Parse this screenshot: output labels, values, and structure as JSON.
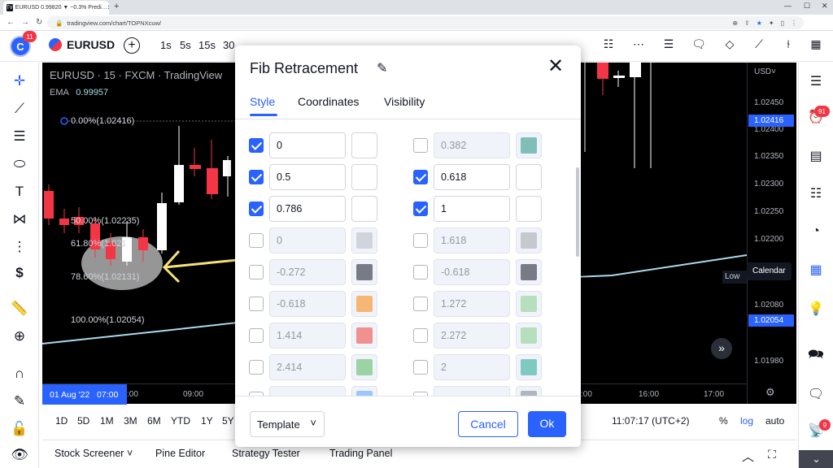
{
  "browser": {
    "tab_title": "EURUSD 0.99820 ▼ −0.3% Predi…",
    "favicon_text": "TV",
    "url": "tradingview.com/chart/TOPNXcuw/"
  },
  "toolbar": {
    "avatar_letter": "C",
    "avatar_badge": "11",
    "symbol": "EURUSD",
    "timeframes": [
      "1s",
      "5s",
      "15s",
      "30"
    ]
  },
  "chart": {
    "legend_title": "EURUSD · 15 · FXCM · TradingView",
    "ema_label": "EMA",
    "ema_value": "0.99957",
    "fib_labels": [
      "0.00%(1.02416)",
      "50.00%(1.02235)",
      "61.80%(1.021",
      "78.60%(1.02131)",
      "100.00%(1.02054)"
    ],
    "low_label": "Low",
    "calendar_tooltip": "Calendar",
    "price_axis": {
      "currency": "USD˅",
      "ticks": [
        "1.02450",
        "1.02400",
        "1.02350",
        "1.02300",
        "1.02250",
        "1.02200",
        "1.02080",
        "1.01980"
      ],
      "badge_top": "1.02416",
      "badge_bottom": "1.02054"
    },
    "time_axis": {
      "cursor": "01 Aug '22   07:00",
      "ticks": [
        ":00",
        "09:00",
        ":00",
        "16:00",
        "17:00"
      ]
    },
    "candle_colors": {
      "up": "#ffffff",
      "down": "#f23645"
    }
  },
  "bottom_bar": {
    "ranges": [
      "1D",
      "5D",
      "1M",
      "3M",
      "6M",
      "YTD",
      "1Y",
      "5Y"
    ],
    "clock": "11:07:17 (UTC+2)",
    "percent": "%",
    "log": "log",
    "auto": "auto"
  },
  "panels": [
    "Stock Screener",
    "Pine Editor",
    "Strategy Tester",
    "Trading Panel"
  ],
  "right_toolbar": {
    "alerts_badge": "91",
    "notif_badge": "9"
  },
  "dialog": {
    "title": "Fib Retracement",
    "tabs": [
      "Style",
      "Coordinates",
      "Visibility"
    ],
    "levels_left": [
      {
        "checked": true,
        "value": "0",
        "color": "#ffffff"
      },
      {
        "checked": true,
        "value": "0.5",
        "color": "#ffffff"
      },
      {
        "checked": true,
        "value": "0.786",
        "color": "#ffffff"
      },
      {
        "checked": false,
        "value": "0",
        "color": "#d1d4dc"
      },
      {
        "checked": false,
        "value": "-0.272",
        "color": "#787b86"
      },
      {
        "checked": false,
        "value": "-0.618",
        "color": "#f7b774"
      },
      {
        "checked": false,
        "value": "1.414",
        "color": "#f0908f"
      },
      {
        "checked": false,
        "value": "2.414",
        "color": "#9bd3a5"
      },
      {
        "checked": false,
        "value": "",
        "color": "#9fc5f8"
      }
    ],
    "levels_right": [
      {
        "checked": false,
        "value": "0.382",
        "color": "#7fbfb8"
      },
      {
        "checked": true,
        "value": "0.618",
        "color": "#ffffff"
      },
      {
        "checked": true,
        "value": "1",
        "color": "#ffffff"
      },
      {
        "checked": false,
        "value": "1.618",
        "color": "#c5c8ce"
      },
      {
        "checked": false,
        "value": "-0.618",
        "color": "#787b86"
      },
      {
        "checked": false,
        "value": "1.272",
        "color": "#b7dfbd"
      },
      {
        "checked": false,
        "value": "2.272",
        "color": "#b7dfbd"
      },
      {
        "checked": false,
        "value": "2",
        "color": "#7fc9c2"
      },
      {
        "checked": false,
        "value": "",
        "color": "#b2b5be"
      }
    ],
    "template_label": "Template",
    "cancel_label": "Cancel",
    "ok_label": "Ok"
  }
}
